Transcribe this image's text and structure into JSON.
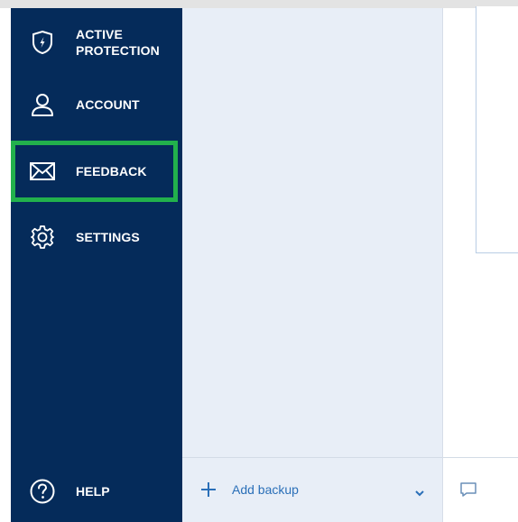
{
  "colors": {
    "sidebar_bg": "#052b5a",
    "highlight": "#22b14c",
    "panel_bg": "#e8eef7",
    "accent": "#2a6fb8"
  },
  "sidebar": {
    "items": [
      {
        "id": "active-protection",
        "label_line1": "ACTIVE",
        "label_line2": "PROTECTION",
        "icon": "shield-bolt-icon"
      },
      {
        "id": "account",
        "label": "ACCOUNT",
        "icon": "user-icon"
      },
      {
        "id": "feedback",
        "label": "FEEDBACK",
        "icon": "envelope-icon",
        "highlighted": true
      },
      {
        "id": "settings",
        "label": "SETTINGS",
        "icon": "gear-icon"
      }
    ],
    "help": {
      "label": "HELP",
      "icon": "question-circle-icon"
    }
  },
  "backup_panel": {
    "add_backup_label": "Add backup",
    "add_icon": "plus-icon",
    "dropdown_icon": "chevron-down-icon"
  },
  "main": {
    "footer_icon": "comment-icon"
  }
}
